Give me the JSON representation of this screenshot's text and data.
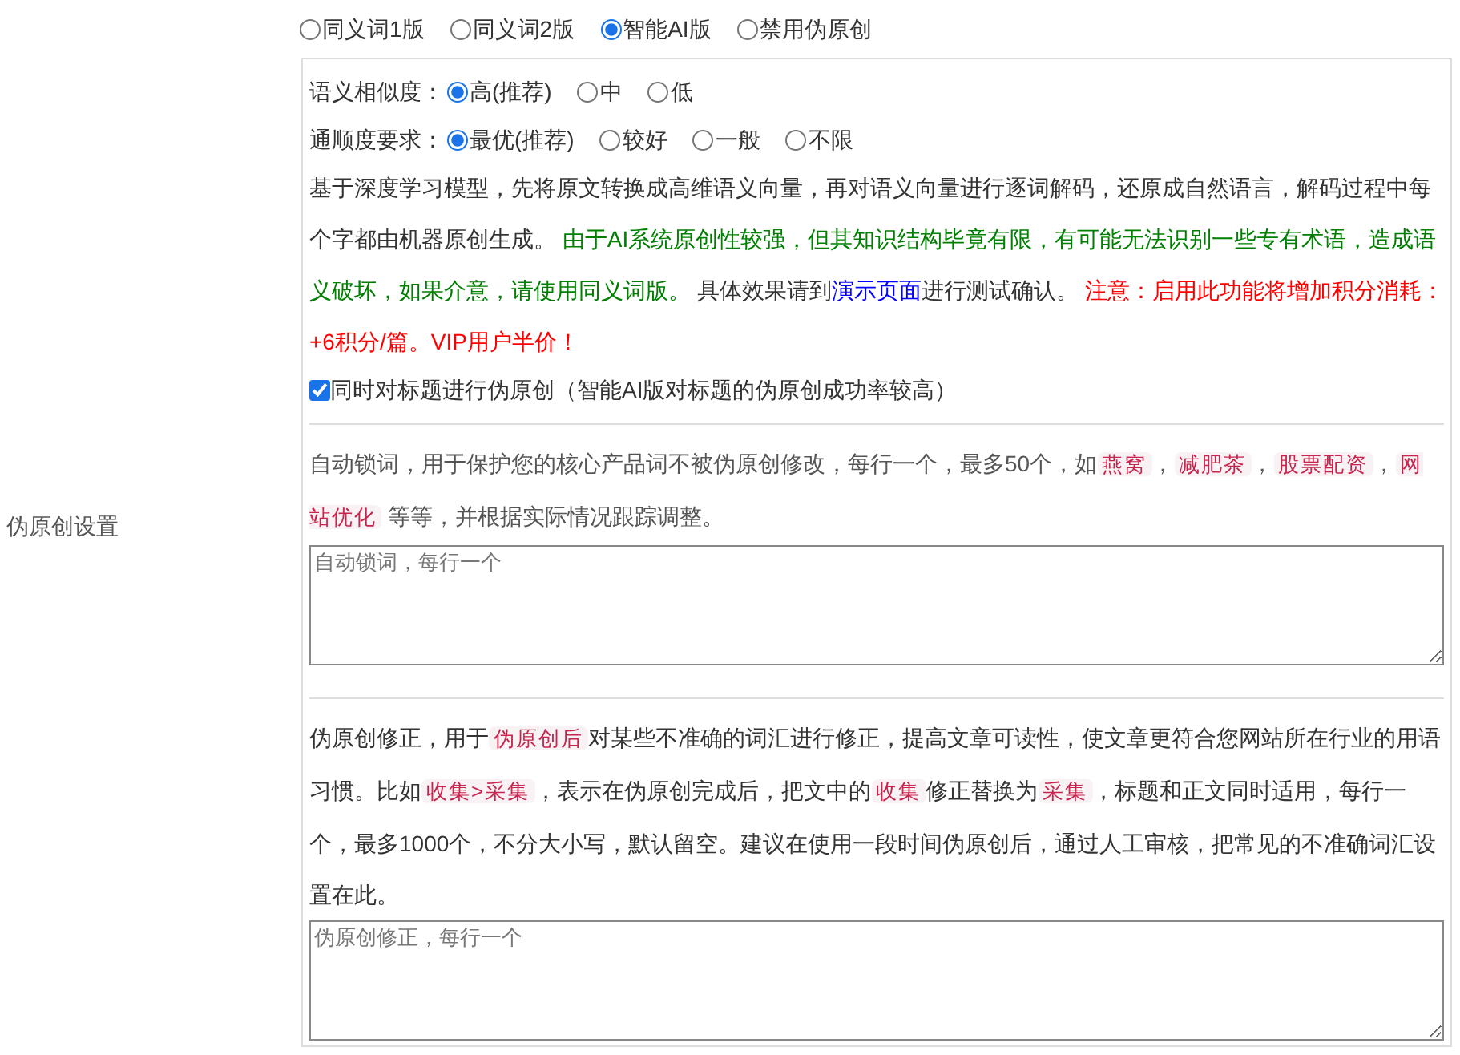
{
  "row_label": "伪原创设置",
  "modes": [
    {
      "label": "同义词1版",
      "selected": false
    },
    {
      "label": "同义词2版",
      "selected": false
    },
    {
      "label": "智能AI版",
      "selected": true
    },
    {
      "label": "禁用伪原创",
      "selected": false
    }
  ],
  "similarity": {
    "label": "语义相似度：",
    "options": [
      {
        "label": "高(推荐)",
        "selected": true
      },
      {
        "label": "中",
        "selected": false
      },
      {
        "label": "低",
        "selected": false
      }
    ]
  },
  "fluency": {
    "label": "通顺度要求：",
    "options": [
      {
        "label": "最优(推荐)",
        "selected": true
      },
      {
        "label": "较好",
        "selected": false
      },
      {
        "label": "一般",
        "selected": false
      },
      {
        "label": "不限",
        "selected": false
      }
    ]
  },
  "ai_description": [
    {
      "kind": "text",
      "text": "基于深度学习模型，先将原文转换成高维语义向量，再对语义向量进行逐词解码，还原成自然语言，解码过程中每个字都由机器原创生成。 "
    },
    {
      "kind": "green",
      "text": "由于AI系统原创性较强，但其知识结构毕竟有限，有可能无法识别一些专有术语，造成语义破坏，如果介意，请使用同义词版。"
    },
    {
      "kind": "text",
      "text": " 具体效果请到"
    },
    {
      "kind": "link",
      "text": "演示页面"
    },
    {
      "kind": "text",
      "text": "进行测试确认。 "
    },
    {
      "kind": "red",
      "text": "注意：启用此功能将增加积分消耗：+6积分/篇。VIP用户半价！"
    }
  ],
  "title_option": {
    "label": "同时对标题进行伪原创（智能AI版对标题的伪原创成功率较高）",
    "checked": true
  },
  "lock_words": {
    "description": [
      {
        "kind": "text",
        "text": "自动锁词，用于保护您的核心产品词不被伪原创修改，每行一个，最多50个，如"
      },
      {
        "kind": "code",
        "text": "燕窝"
      },
      {
        "kind": "text",
        "text": "，"
      },
      {
        "kind": "code",
        "text": "减肥茶"
      },
      {
        "kind": "text",
        "text": "，"
      },
      {
        "kind": "code",
        "text": "股票配资"
      },
      {
        "kind": "text",
        "text": "，"
      },
      {
        "kind": "code",
        "text": "网站优化"
      },
      {
        "kind": "text",
        "text": " 等等，并根据实际情况跟踪调整。"
      }
    ],
    "placeholder": "自动锁词，每行一个"
  },
  "corrections": {
    "description": [
      {
        "kind": "text",
        "text": "伪原创修正，用于"
      },
      {
        "kind": "code",
        "text": "伪原创后"
      },
      {
        "kind": "text",
        "text": "对某些不准确的词汇进行修正，提高文章可读性，使文章更符合您网站所在行业的用语习惯。比如"
      },
      {
        "kind": "code",
        "text": "收集>采集"
      },
      {
        "kind": "text",
        "text": "，表示在伪原创完成后，把文中的"
      },
      {
        "kind": "code",
        "text": "收集"
      },
      {
        "kind": "text",
        "text": "修正替换为"
      },
      {
        "kind": "code",
        "text": "采集"
      },
      {
        "kind": "text",
        "text": "，标题和正文同时适用，每行一个，最多1000个，不分大小写，默认留空。建议在使用一段时间伪原创后，通过人工审核，把常见的不准确词汇设置在此。"
      }
    ],
    "placeholder": "伪原创修正，每行一个"
  }
}
